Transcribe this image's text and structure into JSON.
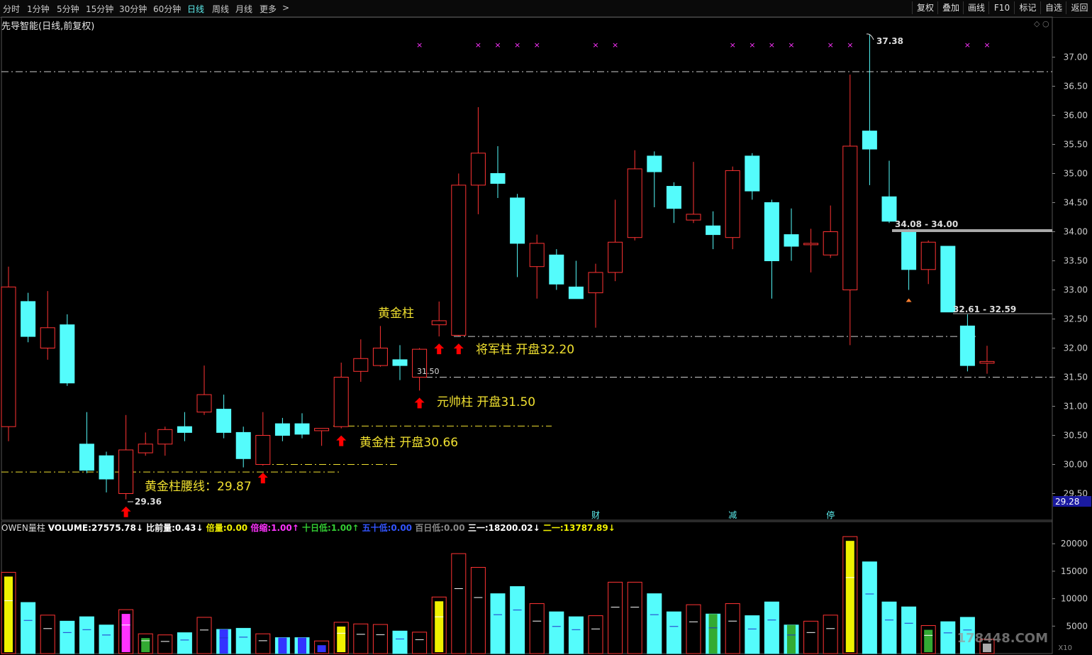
{
  "toolbar": {
    "periods": [
      "分时",
      "1分钟",
      "5分钟",
      "15分钟",
      "30分钟",
      "60分钟",
      "日线",
      "周线",
      "月线",
      "更多"
    ],
    "active_period": "日线",
    "more_chevron": ">",
    "right_buttons": [
      "复权",
      "叠加",
      "画线",
      "F10",
      "标记",
      "自选",
      "返回"
    ]
  },
  "chart_title": "先导智能(日线,前复权)",
  "scroll_marks": "◇ ○",
  "colors": {
    "up_candle": "#ff3333",
    "down_candle": "#54fcfc",
    "annotation_yellow": "#f0e030",
    "marker_magenta": "#ff33ff",
    "arrow_red": "#ff0000",
    "background": "#000000"
  },
  "chart_data": {
    "type": "candlestick",
    "ylim": [
      29.2,
      37.4
    ],
    "y_ticks": [
      29.5,
      30.0,
      30.5,
      31.0,
      31.5,
      32.0,
      32.5,
      33.0,
      33.5,
      34.0,
      34.5,
      35.0,
      35.5,
      36.0,
      36.5,
      37.0
    ],
    "y_tick_labels": [
      "29.50",
      "30.00",
      "30.50",
      "31.00",
      "31.50",
      "32.00",
      "32.50",
      "33.00",
      "33.50",
      "34.00",
      "34.50",
      "35.00",
      "35.50",
      "36.00",
      "36.50",
      "37.00"
    ],
    "current_price_tag": "29.28",
    "candles": [
      {
        "o": 30.65,
        "h": 33.4,
        "l": 30.4,
        "c": 33.05
      },
      {
        "o": 32.8,
        "h": 32.95,
        "l": 32.1,
        "c": 32.2
      },
      {
        "o": 32.0,
        "h": 32.98,
        "l": 31.8,
        "c": 32.35
      },
      {
        "o": 32.4,
        "h": 32.58,
        "l": 31.35,
        "c": 31.4
      },
      {
        "o": 30.35,
        "h": 30.9,
        "l": 29.85,
        "c": 29.9
      },
      {
        "o": 30.15,
        "h": 30.22,
        "l": 29.52,
        "c": 29.75
      },
      {
        "o": 29.5,
        "h": 30.85,
        "l": 29.4,
        "c": 30.25
      },
      {
        "o": 30.2,
        "h": 30.55,
        "l": 30.15,
        "c": 30.35
      },
      {
        "o": 30.35,
        "h": 30.65,
        "l": 30.15,
        "c": 30.6
      },
      {
        "o": 30.65,
        "h": 30.9,
        "l": 30.4,
        "c": 30.55
      },
      {
        "o": 30.9,
        "h": 31.7,
        "l": 30.85,
        "c": 31.2
      },
      {
        "o": 30.95,
        "h": 31.2,
        "l": 30.45,
        "c": 30.55
      },
      {
        "o": 30.55,
        "h": 30.65,
        "l": 29.95,
        "c": 30.1
      },
      {
        "o": 30.0,
        "h": 30.9,
        "l": 29.98,
        "c": 30.5
      },
      {
        "o": 30.7,
        "h": 30.8,
        "l": 30.4,
        "c": 30.5
      },
      {
        "o": 30.7,
        "h": 30.88,
        "l": 30.45,
        "c": 30.52
      },
      {
        "o": 30.58,
        "h": 30.6,
        "l": 30.32,
        "c": 30.62
      },
      {
        "o": 30.65,
        "h": 31.75,
        "l": 30.62,
        "c": 31.5
      },
      {
        "o": 31.6,
        "h": 32.15,
        "l": 31.42,
        "c": 31.82
      },
      {
        "o": 31.7,
        "h": 32.38,
        "l": 31.68,
        "c": 32.0
      },
      {
        "o": 31.8,
        "h": 32.05,
        "l": 31.45,
        "c": 31.7
      },
      {
        "o": 31.5,
        "h": 32.0,
        "l": 31.27,
        "c": 31.98
      },
      {
        "o": 32.4,
        "h": 32.8,
        "l": 32.2,
        "c": 32.47
      },
      {
        "o": 32.22,
        "h": 35.0,
        "l": 32.2,
        "c": 34.8
      },
      {
        "o": 34.8,
        "h": 36.14,
        "l": 34.3,
        "c": 35.35
      },
      {
        "o": 35.0,
        "h": 35.47,
        "l": 34.58,
        "c": 34.83
      },
      {
        "o": 34.58,
        "h": 34.65,
        "l": 33.22,
        "c": 33.8
      },
      {
        "o": 33.4,
        "h": 33.95,
        "l": 32.85,
        "c": 33.8
      },
      {
        "o": 33.6,
        "h": 33.7,
        "l": 33.0,
        "c": 33.1
      },
      {
        "o": 33.05,
        "h": 33.5,
        "l": 32.85,
        "c": 32.85
      },
      {
        "o": 32.95,
        "h": 33.45,
        "l": 32.35,
        "c": 33.3
      },
      {
        "o": 33.3,
        "h": 34.55,
        "l": 33.15,
        "c": 33.82
      },
      {
        "o": 33.9,
        "h": 35.4,
        "l": 33.85,
        "c": 35.08
      },
      {
        "o": 35.3,
        "h": 35.38,
        "l": 34.42,
        "c": 35.03
      },
      {
        "o": 34.78,
        "h": 34.85,
        "l": 34.15,
        "c": 34.4
      },
      {
        "o": 34.2,
        "h": 35.2,
        "l": 34.15,
        "c": 34.3
      },
      {
        "o": 34.1,
        "h": 34.35,
        "l": 33.7,
        "c": 33.95
      },
      {
        "o": 33.9,
        "h": 35.12,
        "l": 33.7,
        "c": 35.05
      },
      {
        "o": 35.3,
        "h": 35.35,
        "l": 34.55,
        "c": 34.7
      },
      {
        "o": 34.5,
        "h": 34.55,
        "l": 32.85,
        "c": 33.5
      },
      {
        "o": 33.95,
        "h": 34.4,
        "l": 33.5,
        "c": 33.75
      },
      {
        "o": 33.78,
        "h": 34.05,
        "l": 33.3,
        "c": 33.8
      },
      {
        "o": 33.6,
        "h": 34.45,
        "l": 33.55,
        "c": 34.0
      },
      {
        "o": 33.0,
        "h": 36.7,
        "l": 32.05,
        "c": 35.47
      },
      {
        "o": 35.73,
        "h": 37.38,
        "l": 34.8,
        "c": 35.42
      },
      {
        "o": 34.6,
        "h": 35.22,
        "l": 34.15,
        "c": 34.18
      },
      {
        "o": 34.0,
        "h": 34.05,
        "l": 33.0,
        "c": 33.35
      },
      {
        "o": 33.35,
        "h": 33.85,
        "l": 33.1,
        "c": 33.82
      },
      {
        "o": 33.75,
        "h": 33.75,
        "l": 32.62,
        "c": 32.62
      },
      {
        "o": 32.38,
        "h": 32.58,
        "l": 31.6,
        "c": 31.7
      },
      {
        "o": 31.74,
        "h": 32.04,
        "l": 31.56,
        "c": 31.77
      }
    ]
  },
  "ref_lines": [
    {
      "price": 36.75,
      "color": "#cccccc"
    },
    {
      "price": 32.2,
      "color": "#cccccc"
    },
    {
      "price": 31.5,
      "color": "#cccccc"
    },
    {
      "price": 30.66,
      "color": "#f0e030"
    },
    {
      "price": 30.0,
      "color": "#f0e030"
    },
    {
      "price": 29.87,
      "color": "#f0e030"
    }
  ],
  "magenta_marker_candles": [
    21,
    24,
    25,
    26,
    27,
    30,
    31,
    37,
    38,
    39,
    40,
    42,
    43,
    49,
    50
  ],
  "golden_bar_label_candle": 21,
  "red_arrows": [
    6,
    13,
    17,
    21,
    22,
    23
  ],
  "orange_marker_candle": 46,
  "event_markers": [
    {
      "text": "财",
      "candle": 30
    },
    {
      "text": "减",
      "candle": 37
    },
    {
      "text": "停",
      "candle": 42
    }
  ],
  "annotations": {
    "golden_bar_top": "黄金柱",
    "general_bar": "将军柱 开盘32.20",
    "marshal_bar": "元帅柱 开盘31.50",
    "golden_bar_open": "黄金柱 开盘30.66",
    "golden_waist": "黄金柱腰线：29.87",
    "low_label": "29.36",
    "high_label": "37.38",
    "price_label_3150": "31.50",
    "range_label_upper": "34.08 - 34.00",
    "range_label_lower": "32.61 - 32.59"
  },
  "volume": {
    "indicator_name": "OWEN量柱",
    "ylim": [
      0,
      23000
    ],
    "y_ticks": [
      5000,
      10000,
      15000,
      20000
    ],
    "y_tick_labels": [
      "5000",
      "10000",
      "15000",
      "20000"
    ],
    "y_unit": "X10",
    "values": [
      14800,
      9300,
      7000,
      5900,
      6700,
      5200,
      8000,
      3600,
      3400,
      3800,
      6600,
      4400,
      4600,
      3600,
      2900,
      2900,
      2300,
      5700,
      5400,
      5300,
      4100,
      3900,
      10300,
      18200,
      15700,
      10900,
      12200,
      9100,
      7600,
      6700,
      6900,
      13000,
      13000,
      10900,
      7600,
      8900,
      7200,
      9100,
      6900,
      9400,
      5200,
      5900,
      7000,
      21300,
      16700,
      9400,
      8500,
      5100,
      5800,
      6600,
      2600
    ],
    "special_colors": {
      "0": "#f0f000",
      "6": "#ff33ff",
      "7": "#33aa33",
      "11": "#3333ff",
      "14": "#3333ff",
      "15": "#3333ff",
      "16": "#3333ff",
      "17": "#f0f000",
      "22": "#f0f000",
      "36": "#33aa33",
      "40": "#33aa33",
      "43": "#f0f000",
      "47": "#33aa33",
      "50": "#aaaaaa"
    },
    "legend": [
      {
        "label": "VOLUME:",
        "value": "27575.78",
        "arrow": "↓",
        "color": "#ffffff"
      },
      {
        "label": "比前量:",
        "value": "0.43",
        "arrow": "↓",
        "color": "#ffffff"
      },
      {
        "label": "倍量:",
        "value": "0.00",
        "arrow": "",
        "color": "#f0f000"
      },
      {
        "label": "倍缩:",
        "value": "1.00",
        "arrow": "↑",
        "color": "#ff33ff"
      },
      {
        "label": "十日低:",
        "value": "1.00",
        "arrow": "↑",
        "color": "#33cc33"
      },
      {
        "label": "五十低:",
        "value": "0.00",
        "arrow": "",
        "color": "#3355ff"
      },
      {
        "label": "百日低:",
        "value": "0.00",
        "arrow": "",
        "color": "#888888"
      },
      {
        "label": "三一:",
        "value": "18200.02",
        "arrow": "↓",
        "color": "#ffffff"
      },
      {
        "label": "二一:",
        "value": "13787.89",
        "arrow": "↓",
        "color": "#f0f000"
      }
    ]
  },
  "watermark": "178448.COM"
}
